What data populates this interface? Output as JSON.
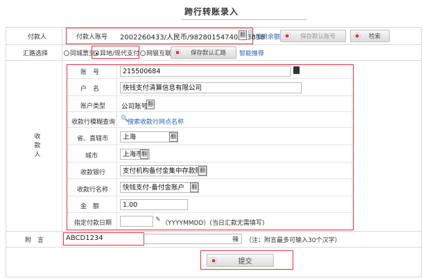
{
  "page": {
    "title": "跨行转账录入"
  },
  "payer": {
    "label": "付款人",
    "account_label": "付款人账号",
    "account_value": "2002260433/人民币/98280154740013838",
    "kb_glyph": "翻",
    "search_glyph": "🔍",
    "balance_link": "可用余额",
    "save_default_label": "保存默认账号",
    "check_label": "检索"
  },
  "route": {
    "label": "汇路选择",
    "options": [
      "同城票交",
      "异地/现代支付",
      "网银互联"
    ],
    "selected": "异地/现代支付",
    "save_route_label": "保存默认汇路",
    "smart_link": "智能推荐"
  },
  "payee": {
    "label": "收款人",
    "account_no_label": "账　号",
    "account_no_value": "215500684",
    "name_label": "户　名",
    "name_value": "快钱支付清算信息有限公司",
    "acct_type_label": "账户类型",
    "acct_type_value": "公司账号",
    "fuzzy_label": "收款行模糊查询",
    "fuzzy_link": "搜索收款行网点名称",
    "province_label": "省、直辖市",
    "province_value": "上海",
    "city_label": "城市",
    "city_value": "上海市",
    "bank_label": "收款银行",
    "bank_value": "支付机构备付金集中存款账户",
    "bank_name_label": "收款行名称",
    "bank_name_value": "快钱支付-备付金账户",
    "amount_label": "金　额",
    "amount_value": "1.00",
    "date_label": "指定付款日期",
    "date_value": "",
    "date_hint": "（YYYYMMDD）(当日汇款无需填写)"
  },
  "memo": {
    "label": "附　言",
    "value": "ABCD1234",
    "kb_glyph": "辣",
    "hint": "（注：附言最多可输入30个汉字）"
  },
  "submit": {
    "label": "提交"
  }
}
